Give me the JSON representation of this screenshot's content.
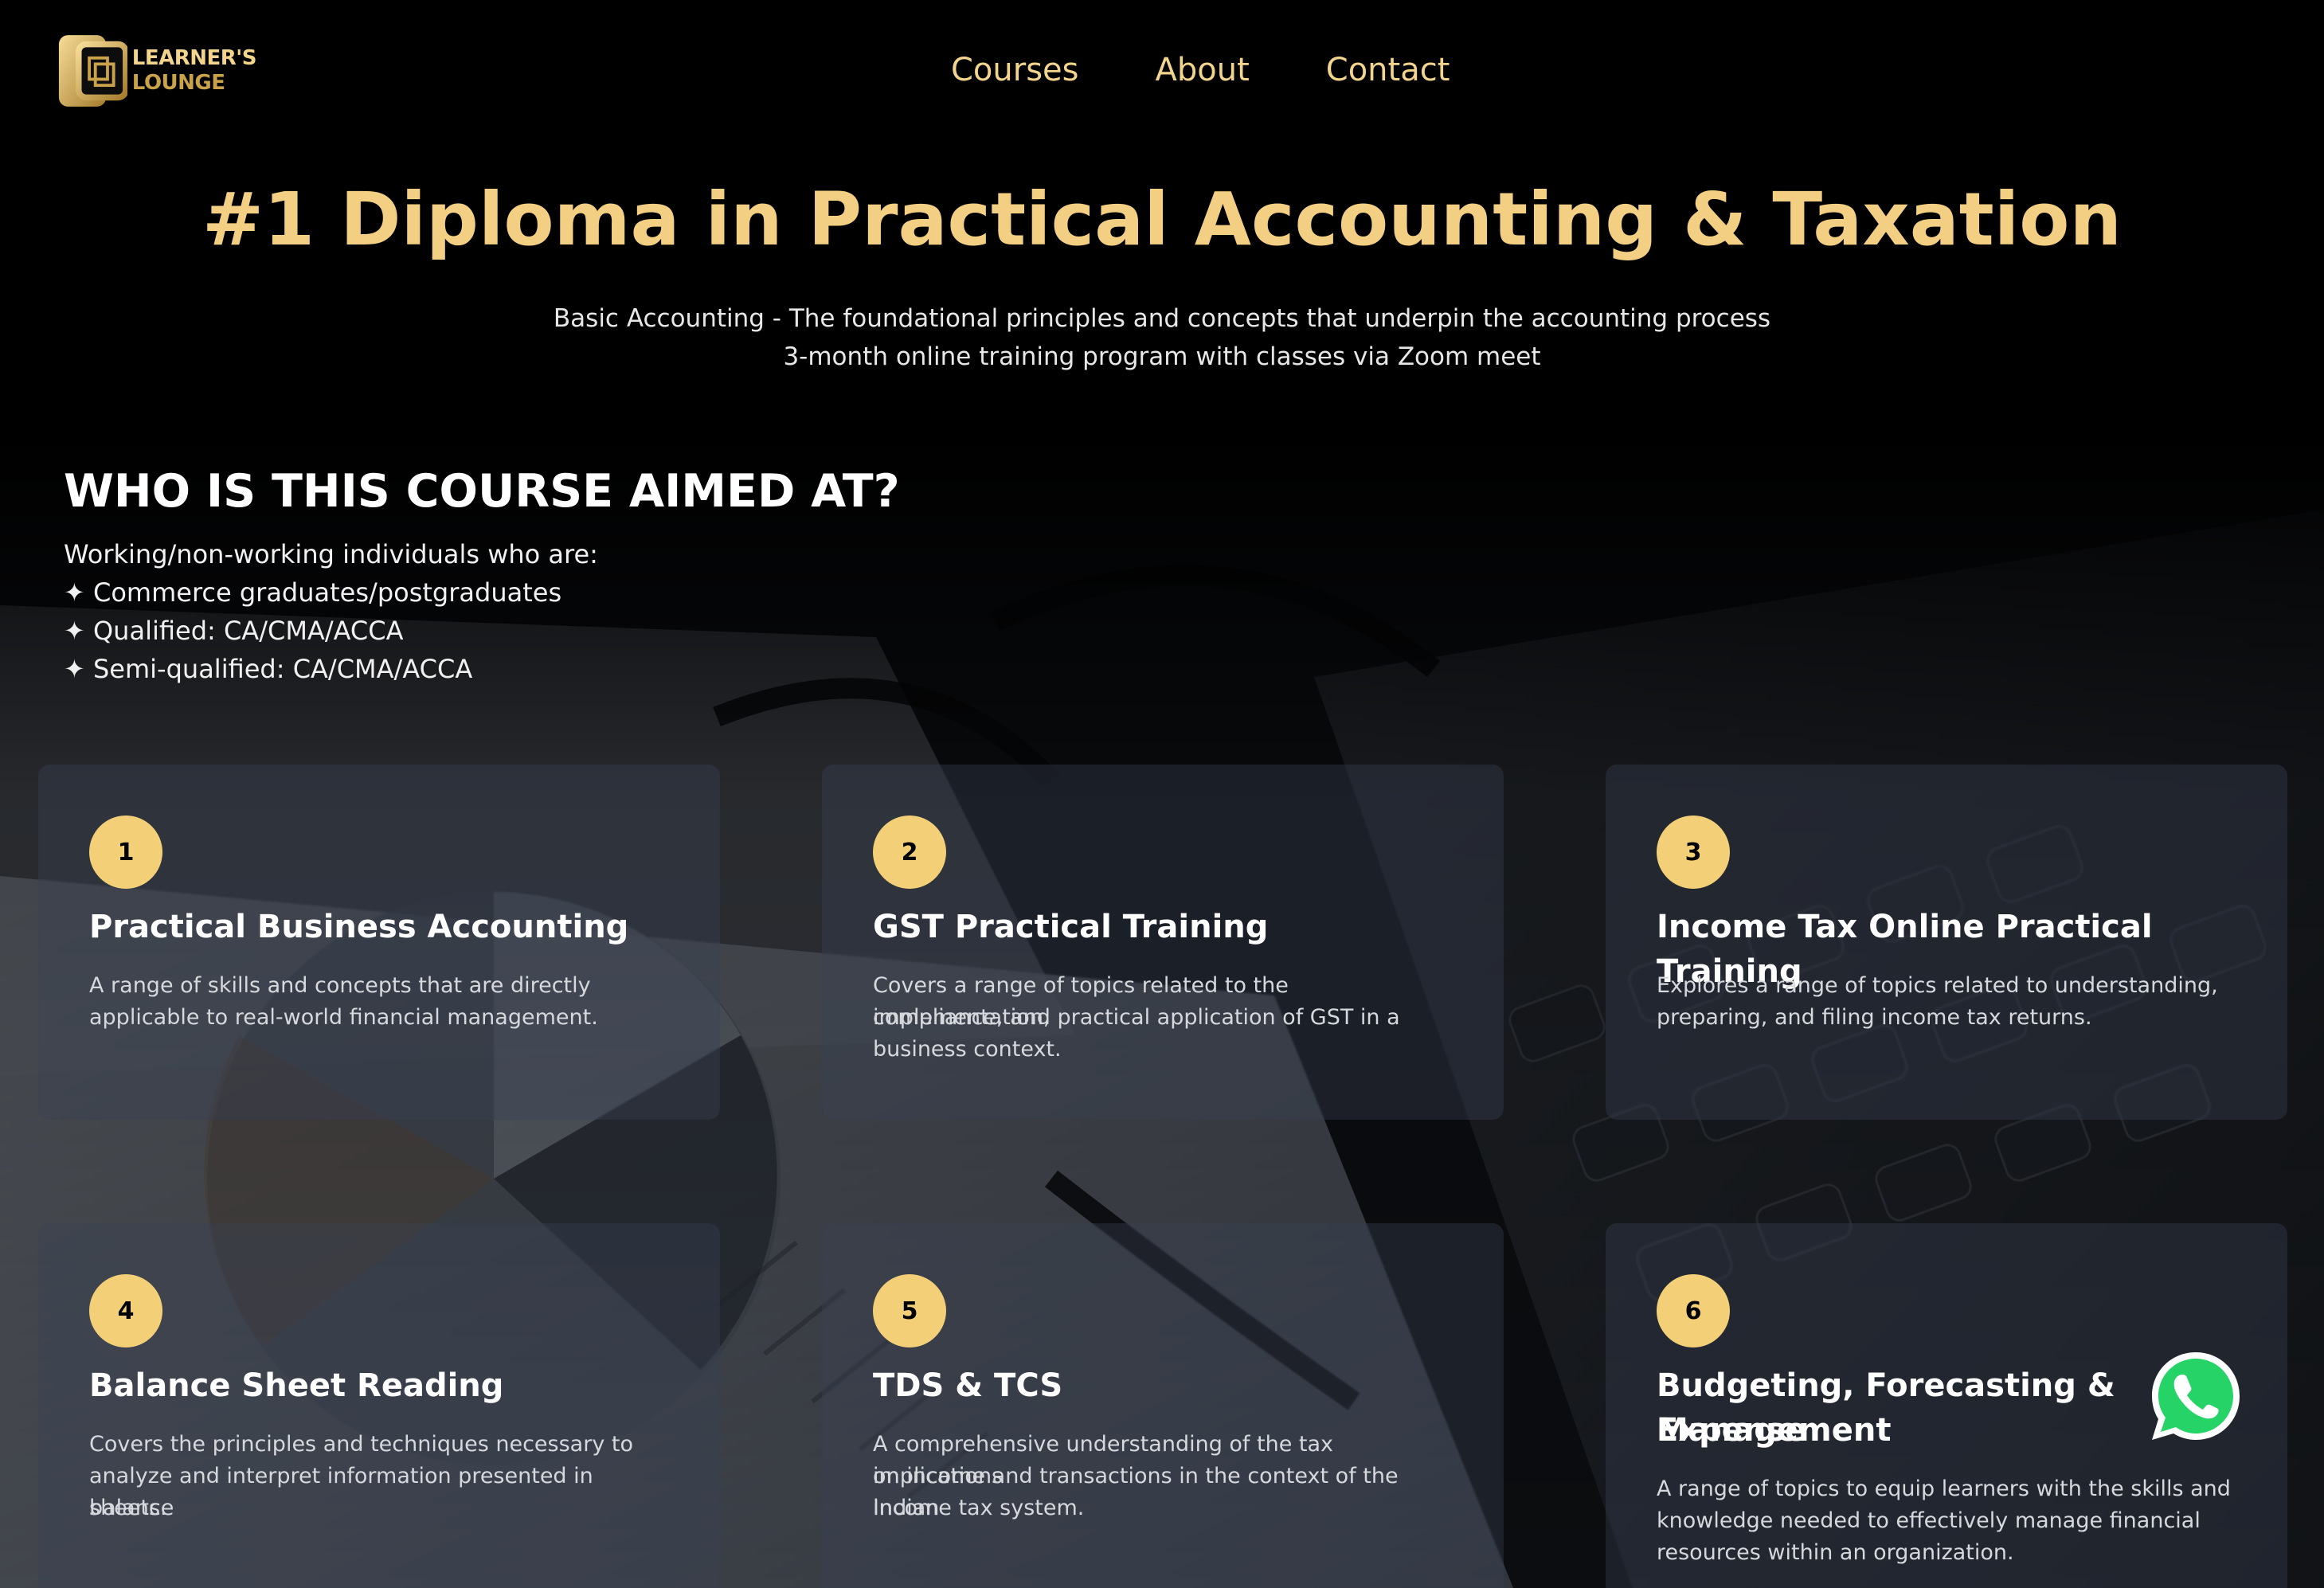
{
  "brand": {
    "line1": "LEARNER'S",
    "line2": "LOUNGE",
    "logo_icon": "learners-lounge-logo"
  },
  "nav": {
    "items": [
      {
        "label": "Courses"
      },
      {
        "label": "About"
      },
      {
        "label": "Contact"
      }
    ]
  },
  "hero": {
    "title": "#1 Diploma in Practical Accounting & Taxation",
    "subtitle_1": "Basic Accounting - The foundational principles and concepts that underpin the accounting process",
    "subtitle_2": "3-month online training program with classes via Zoom meet"
  },
  "audience": {
    "title": "WHO IS THIS COURSE AIMED AT?",
    "intro": "Working/non-working individuals who are:",
    "items": [
      "✦ Commerce graduates/postgraduates",
      "✦ Qualified: CA/CMA/ACCA",
      "✦ Semi-qualified: CA/CMA/ACCA"
    ]
  },
  "courses": [
    {
      "num": "1",
      "title": "Practical Business Accounting",
      "desc_lines": [
        "A range of skills and concepts that are directly",
        "applicable to real-world financial management."
      ]
    },
    {
      "num": "2",
      "title": "GST Practical Training",
      "desc_lines": [
        "Covers a range of topics related to the implementation,",
        "compliance, and practical application of GST in a",
        "business context."
      ]
    },
    {
      "num": "3",
      "title": "Income Tax Online Practical Training",
      "desc_lines": [
        "Explores a range of topics related to understanding,",
        "preparing, and filing income tax returns."
      ]
    },
    {
      "num": "4",
      "title": "Balance Sheet Reading",
      "desc_lines": [
        "Covers the principles and techniques necessary to",
        "analyze and interpret information presented in balance",
        "sheets."
      ]
    },
    {
      "num": "5",
      "title": "TDS & TCS",
      "desc_lines": [
        "A comprehensive understanding of the tax implications",
        "on income and transactions in the context of the Indian",
        "income tax system."
      ]
    },
    {
      "num": "6",
      "title_lines": [
        "Budgeting, Forecasting & Expense",
        "Management"
      ],
      "desc_lines": [
        "A range of topics to equip learners with the skills and",
        "knowledge needed to effectively manage financial",
        "resources within an organization."
      ]
    }
  ],
  "whatsapp": {
    "icon": "whatsapp-icon"
  },
  "colors": {
    "gold": "#f2cf82",
    "badge": "#f3cf78",
    "background": "#000000",
    "whatsapp": "#25d366"
  }
}
